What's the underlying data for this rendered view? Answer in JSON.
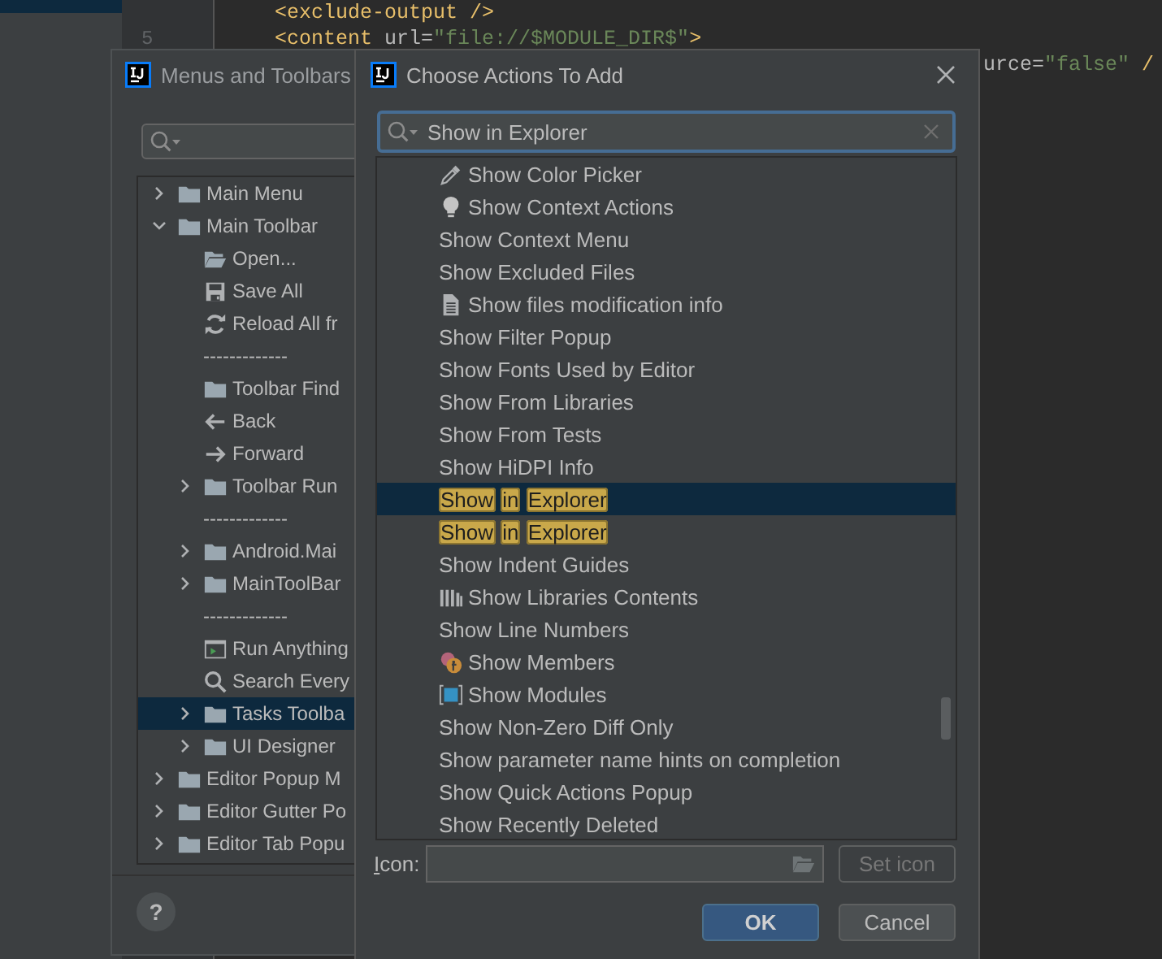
{
  "editor": {
    "lines": [
      {
        "kind": "code",
        "tokens": [
          {
            "kind": "tag",
            "text": "<exclude-output />"
          }
        ]
      },
      {
        "kind": "code",
        "number": "5",
        "tokens": [
          {
            "kind": "tag",
            "text": "<content"
          },
          {
            "kind": "attr",
            "text": " url="
          },
          {
            "kind": "value",
            "text": "\"file://$MODULE_DIR$\""
          },
          {
            "kind": "tag",
            "text": ">"
          }
        ]
      },
      {
        "kind": "continuation",
        "tokens": [
          {
            "kind": "attr",
            "text": "urce="
          },
          {
            "kind": "value",
            "text": "\"false\""
          },
          {
            "kind": "tag",
            "text": " /"
          }
        ]
      }
    ]
  },
  "menus_window": {
    "title": "Menus and Toolbars",
    "tree": [
      {
        "kind": "group",
        "label": "Main Menu",
        "expanded": false,
        "selected": false
      },
      {
        "kind": "group",
        "label": "Main Toolbar",
        "expanded": true,
        "selected": false,
        "children": [
          {
            "kind": "open",
            "label": "Open...",
            "selected": false
          },
          {
            "kind": "save",
            "label": "Save All",
            "selected": false
          },
          {
            "kind": "reload",
            "label": "Reload All fr",
            "selected": false
          },
          {
            "kind": "separator",
            "label": "-------------",
            "selected": false
          },
          {
            "kind": "folder",
            "label": "Toolbar Find",
            "selected": false
          },
          {
            "kind": "back",
            "label": "Back",
            "selected": false
          },
          {
            "kind": "forward",
            "label": "Forward",
            "selected": false
          },
          {
            "kind": "group",
            "label": "Toolbar Run",
            "expanded": false,
            "selected": false
          },
          {
            "kind": "separator",
            "label": "-------------",
            "selected": false
          },
          {
            "kind": "group",
            "label": "Android.Mai",
            "expanded": false,
            "selected": false
          },
          {
            "kind": "group",
            "label": "MainToolBar",
            "expanded": false,
            "selected": false
          },
          {
            "kind": "separator",
            "label": "-------------",
            "selected": false
          },
          {
            "kind": "run",
            "label": "Run Anything",
            "selected": false
          },
          {
            "kind": "search",
            "label": "Search Every",
            "selected": false
          },
          {
            "kind": "group",
            "label": "Tasks Toolba",
            "expanded": false,
            "selected": true
          },
          {
            "kind": "group",
            "label": "UI Designer",
            "expanded": false,
            "selected": false
          }
        ]
      },
      {
        "kind": "group",
        "label": "Editor Popup M",
        "expanded": false,
        "selected": false
      },
      {
        "kind": "group",
        "label": "Editor Gutter Po",
        "expanded": false,
        "selected": false
      },
      {
        "kind": "group",
        "label": "Editor Tab Popu",
        "expanded": false,
        "selected": false
      }
    ],
    "help": "?"
  },
  "dialog": {
    "title": "Choose Actions To Add",
    "search": {
      "value": "Show in Explorer"
    },
    "actions": [
      {
        "kind": "picker",
        "label": "Show Color Picker",
        "selected": false,
        "highlighted": false
      },
      {
        "kind": "bulb",
        "label": "Show Context Actions",
        "selected": false,
        "highlighted": false
      },
      {
        "kind": "plain",
        "label": "Show Context Menu",
        "selected": false,
        "highlighted": false
      },
      {
        "kind": "plain",
        "label": "Show Excluded Files",
        "selected": false,
        "highlighted": false
      },
      {
        "kind": "file",
        "label": "Show files modification info",
        "selected": false,
        "highlighted": false
      },
      {
        "kind": "plain",
        "label": "Show Filter Popup",
        "selected": false,
        "highlighted": false
      },
      {
        "kind": "plain",
        "label": "Show Fonts Used by Editor",
        "selected": false,
        "highlighted": false
      },
      {
        "kind": "plain",
        "label": "Show From Libraries",
        "selected": false,
        "highlighted": false
      },
      {
        "kind": "plain",
        "label": "Show From Tests",
        "selected": false,
        "highlighted": false
      },
      {
        "kind": "plain",
        "label": "Show HiDPI Info",
        "selected": false,
        "highlighted": false
      },
      {
        "kind": "plain",
        "label": "Show in Explorer",
        "selected": true,
        "highlighted": true
      },
      {
        "kind": "plain",
        "label": "Show in Explorer",
        "selected": false,
        "highlighted": true
      },
      {
        "kind": "plain",
        "label": "Show Indent Guides",
        "selected": false,
        "highlighted": false
      },
      {
        "kind": "libraries",
        "label": "Show Libraries Contents",
        "selected": false,
        "highlighted": false
      },
      {
        "kind": "plain",
        "label": "Show Line Numbers",
        "selected": false,
        "highlighted": false
      },
      {
        "kind": "members",
        "label": "Show Members",
        "selected": false,
        "highlighted": false
      },
      {
        "kind": "modules",
        "label": "Show Modules",
        "selected": false,
        "highlighted": false
      },
      {
        "kind": "plain",
        "label": "Show Non-Zero Diff Only",
        "selected": false,
        "highlighted": false
      },
      {
        "kind": "plain",
        "label": "Show parameter name hints on completion",
        "selected": false,
        "highlighted": false
      },
      {
        "kind": "plain",
        "label": "Show Quick Actions Popup",
        "selected": false,
        "highlighted": false
      },
      {
        "kind": "plain",
        "label": "Show Recently Deleted",
        "selected": false,
        "highlighted": false
      }
    ],
    "icon_field": {
      "label": "Icon:",
      "button": {
        "label": "Set icon",
        "disabled": true
      }
    },
    "buttons": [
      {
        "label": "OK",
        "default": true
      },
      {
        "label": "Cancel",
        "default": false
      }
    ]
  }
}
